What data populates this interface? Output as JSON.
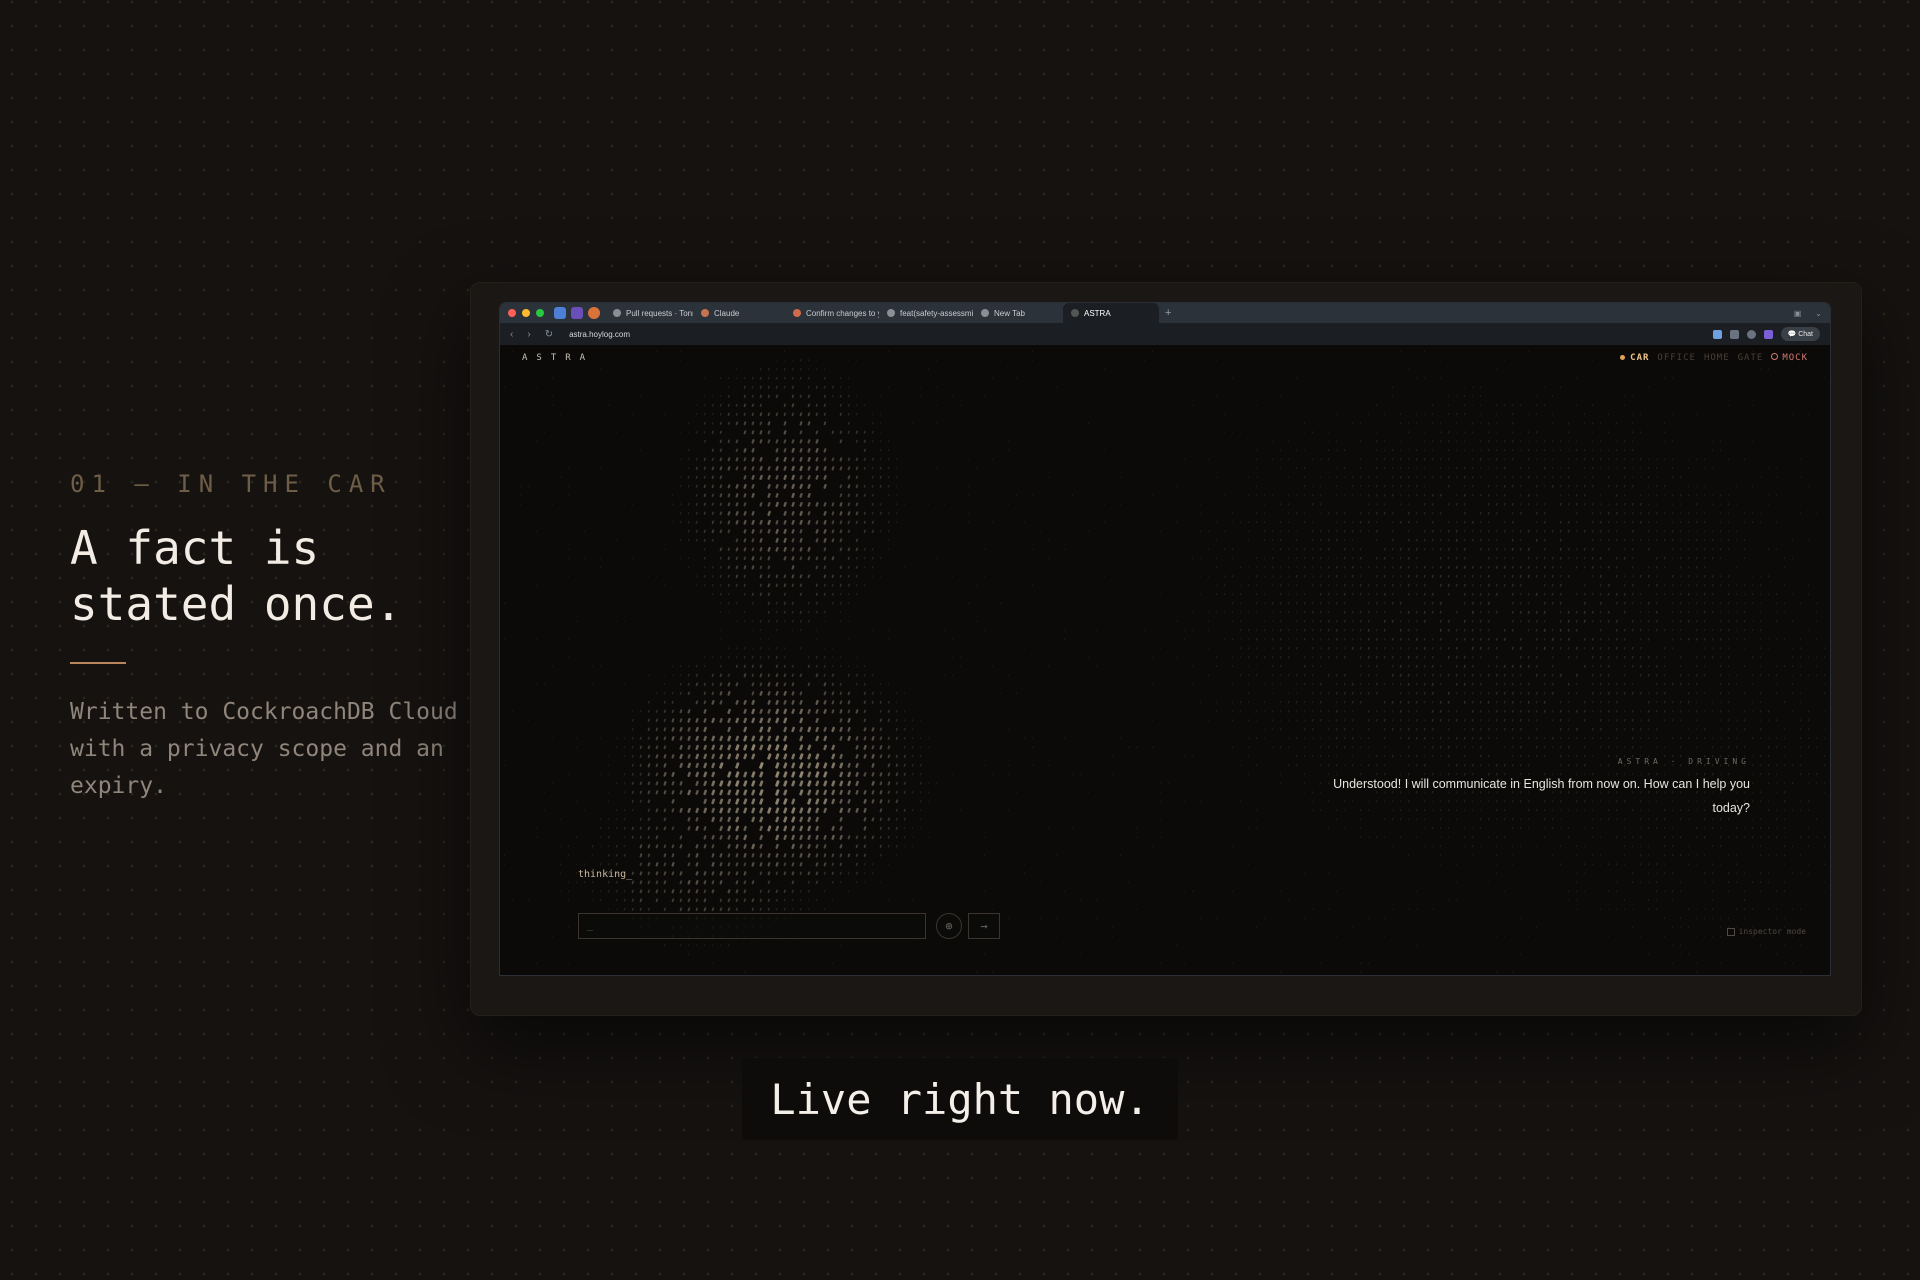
{
  "section": {
    "kicker": "01 — IN THE CAR",
    "headline_line1": "A fact is",
    "headline_line2": "stated once.",
    "description": "Written to CockroachDB Cloud with a privacy scope and an expiry."
  },
  "browser": {
    "tabs": [
      {
        "label": "Pull requests · Tonmoi",
        "active": false
      },
      {
        "label": "Claude",
        "active": false
      },
      {
        "label": "Confirm changes to y",
        "active": false
      },
      {
        "label": "feat(safety-assessmi",
        "active": false
      },
      {
        "label": "New Tab",
        "active": false
      },
      {
        "label": "ASTRA",
        "active": true
      }
    ],
    "new_tab": "+",
    "url": "astra.hoylog.com",
    "chat_button": "Chat",
    "colors": {
      "close": "#ff5f57",
      "minimize": "#febc2e",
      "maximize": "#28c840"
    }
  },
  "app": {
    "brand": "ASTRA",
    "modes": {
      "car": "CAR",
      "office": "OFFICE",
      "home": "HOME",
      "gate": "GATE",
      "mock": "MOCK"
    },
    "reply_label": "ASTRA · DRIVING",
    "reply_text": "Understood! I will communicate in English from now on. How can I help you today?",
    "status": "thinking_",
    "input_value": "_",
    "mic_icon": "⊕",
    "send_icon": "→",
    "inspector": "inspector mode",
    "accent": "#f0c48a"
  },
  "caption": "Live right now."
}
